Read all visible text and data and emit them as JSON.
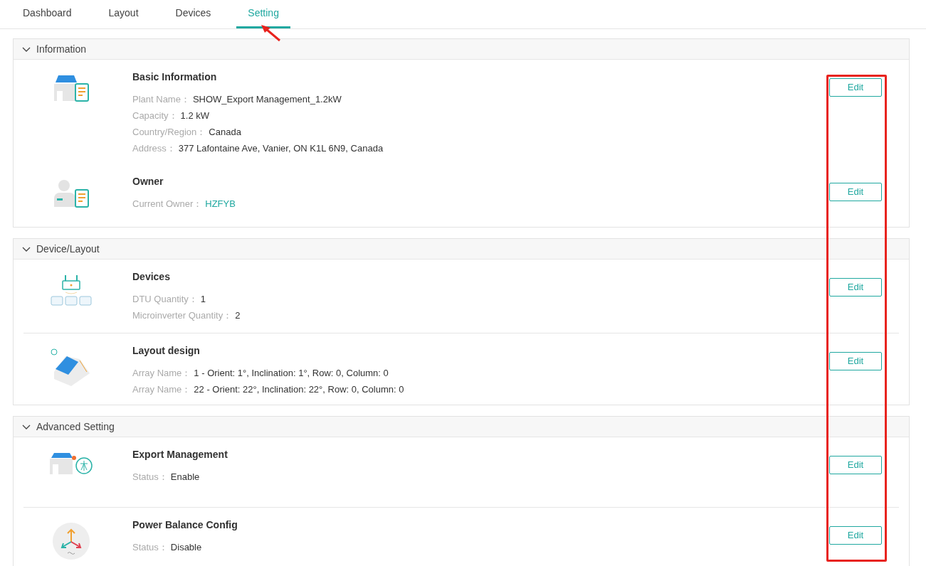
{
  "tabs": [
    {
      "label": "Dashboard",
      "selected": false
    },
    {
      "label": "Layout",
      "selected": false
    },
    {
      "label": "Devices",
      "selected": false
    },
    {
      "label": "Setting",
      "selected": true
    }
  ],
  "sections": [
    {
      "title": "Information",
      "expanded": true,
      "items": [
        {
          "kind": "house-doc",
          "title": "Basic Information",
          "button": "Edit",
          "fields": [
            {
              "label": "Plant Name：",
              "value": "SHOW_Export Management_1.2kW",
              "kind": "text"
            },
            {
              "label": "Capacity：",
              "value": "1.2 kW",
              "kind": "text"
            },
            {
              "label": "Country/Region：",
              "value": "Canada",
              "kind": "text"
            },
            {
              "label": "Address：",
              "value": "377 Lafontaine Ave, Vanier, ON K1L 6N9, Canada",
              "kind": "text"
            }
          ]
        },
        {
          "kind": "person-doc",
          "title": "Owner",
          "button": "Edit",
          "fields": [
            {
              "label": "Current Owner：",
              "value": "HZFYB",
              "kind": "link"
            }
          ]
        }
      ]
    },
    {
      "title": "Device/Layout",
      "expanded": true,
      "items": [
        {
          "kind": "devices",
          "title": "Devices",
          "button": "Edit",
          "fields": [
            {
              "label": "DTU Quantity：",
              "value": "1",
              "kind": "text"
            },
            {
              "label": "Microinverter Quantity：",
              "value": "2",
              "kind": "text"
            }
          ]
        },
        {
          "kind": "roof",
          "title": "Layout design",
          "button": "Edit",
          "fields": [
            {
              "label": "Array Name：",
              "value": "1 - Orient: 1°, Inclination: 1°, Row: 0, Column: 0",
              "kind": "text"
            },
            {
              "label": "Array Name：",
              "value": "22 - Orient: 22°, Inclination: 22°, Row: 0, Column: 0",
              "kind": "text"
            }
          ]
        }
      ]
    },
    {
      "title": "Advanced Setting",
      "expanded": true,
      "items": [
        {
          "kind": "export",
          "title": "Export Management",
          "button": "Edit",
          "fields": [
            {
              "label": "Status：",
              "value": "Enable",
              "kind": "text"
            }
          ]
        },
        {
          "kind": "balance",
          "title": "Power Balance Config",
          "button": "Edit",
          "fields": [
            {
              "label": "Status：",
              "value": "Disable",
              "kind": "text"
            }
          ]
        }
      ]
    }
  ]
}
